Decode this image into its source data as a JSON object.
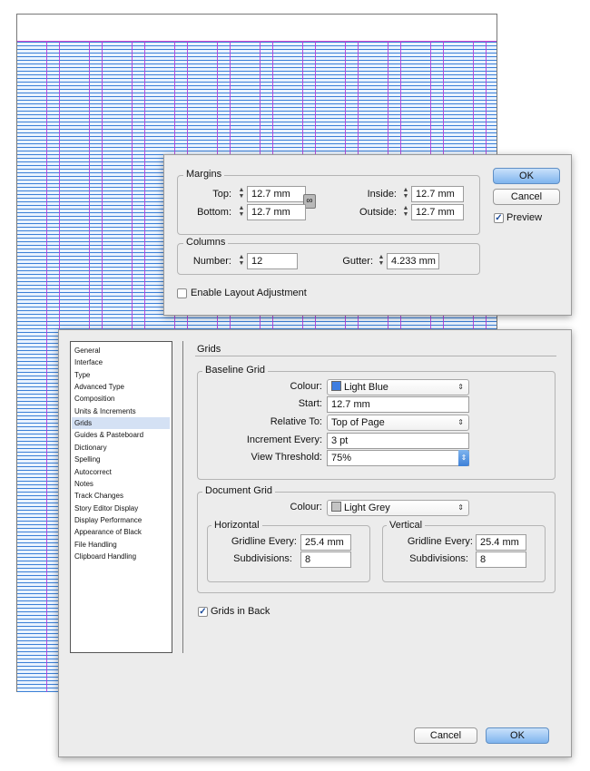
{
  "margins_dialog": {
    "margins_legend": "Margins",
    "top_label": "Top:",
    "top_value": "12.7 mm",
    "bottom_label": "Bottom:",
    "bottom_value": "12.7 mm",
    "inside_label": "Inside:",
    "inside_value": "12.7 mm",
    "outside_label": "Outside:",
    "outside_value": "12.7 mm",
    "columns_legend": "Columns",
    "number_label": "Number:",
    "number_value": "12",
    "gutter_label": "Gutter:",
    "gutter_value": "4.233 mm",
    "enable_layout_label": "Enable Layout Adjustment",
    "enable_layout_checked": false,
    "ok_label": "OK",
    "cancel_label": "Cancel",
    "preview_label": "Preview",
    "preview_checked": true
  },
  "preferences": {
    "categories": [
      "General",
      "Interface",
      "Type",
      "Advanced Type",
      "Composition",
      "Units & Increments",
      "Grids",
      "Guides & Pasteboard",
      "Dictionary",
      "Spelling",
      "Autocorrect",
      "Notes",
      "Track Changes",
      "Story Editor Display",
      "Display Performance",
      "Appearance of Black",
      "File Handling",
      "Clipboard Handling"
    ],
    "selected_category": "Grids",
    "panel_title": "Grids",
    "baseline": {
      "legend": "Baseline Grid",
      "colour_label": "Colour:",
      "colour_value": "Light Blue",
      "colour_swatch": "#3f7ee0",
      "start_label": "Start:",
      "start_value": "12.7 mm",
      "relative_label": "Relative To:",
      "relative_value": "Top of Page",
      "increment_label": "Increment Every:",
      "increment_value": "3 pt",
      "threshold_label": "View Threshold:",
      "threshold_value": "75%"
    },
    "document": {
      "legend": "Document Grid",
      "colour_label": "Colour:",
      "colour_value": "Light Grey",
      "colour_swatch": "#c4c4c4",
      "horizontal": {
        "legend": "Horizontal",
        "gridline_label": "Gridline Every:",
        "gridline_value": "25.4 mm",
        "subdiv_label": "Subdivisions:",
        "subdiv_value": "8"
      },
      "vertical": {
        "legend": "Vertical",
        "gridline_label": "Gridline Every:",
        "gridline_value": "25.4 mm",
        "subdiv_label": "Subdivisions:",
        "subdiv_value": "8"
      }
    },
    "grids_in_back_label": "Grids in Back",
    "grids_in_back_checked": true,
    "cancel_label": "Cancel",
    "ok_label": "OK"
  },
  "icons": {
    "stepper": "up-down-arrows",
    "chain": "chain-link-icon",
    "dropdown": "chevron-up-down"
  }
}
